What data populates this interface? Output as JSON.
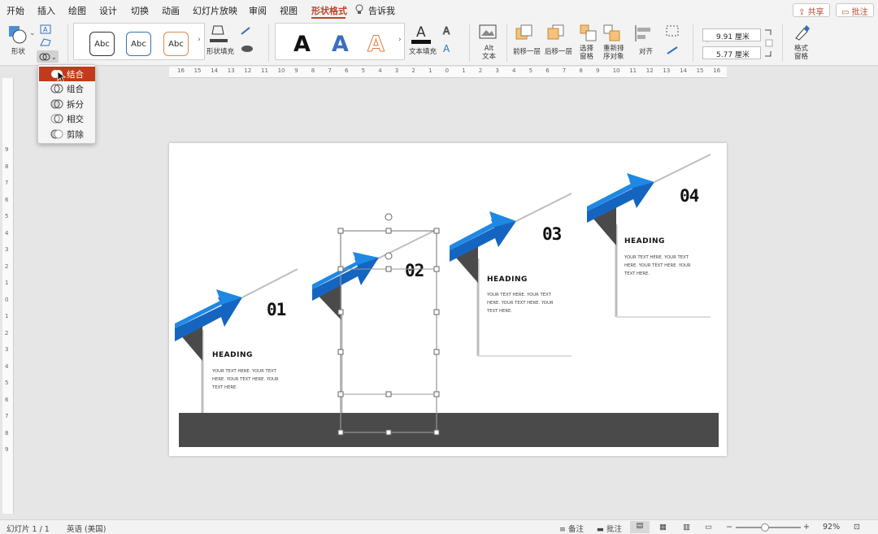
{
  "tabs": [
    {
      "label": "开始"
    },
    {
      "label": "插入"
    },
    {
      "label": "绘图"
    },
    {
      "label": "设计"
    },
    {
      "label": "切换"
    },
    {
      "label": "动画"
    },
    {
      "label": "幻灯片放映"
    },
    {
      "label": "审阅"
    },
    {
      "label": "视图"
    },
    {
      "label": "形状格式"
    },
    {
      "label": "告诉我"
    }
  ],
  "share_label": "共享",
  "comments_label": "批注",
  "ribbon": {
    "shapes": "形状",
    "style_sample": "Abc",
    "fill": "形状填充",
    "wordart_letter": "A",
    "text_fill": "文本填充",
    "alt_text": "Alt\n文本",
    "bring_forward": "前移一层",
    "send_backward": "后移一层",
    "selection_pane": "选择\n窗格",
    "reorder": "重新排\n序对象",
    "align": "对齐",
    "width": "9.91 厘米",
    "height": "5.77 厘米",
    "format_pane": "格式\n窗格"
  },
  "merge_menu": {
    "items": [
      {
        "label": "结合"
      },
      {
        "label": "组合"
      },
      {
        "label": "拆分"
      },
      {
        "label": "相交"
      },
      {
        "label": "剪除"
      }
    ]
  },
  "ruler": {
    "h": [
      "16",
      "15",
      "14",
      "13",
      "12",
      "11",
      "10",
      "9",
      "8",
      "7",
      "6",
      "5",
      "4",
      "3",
      "2",
      "1",
      "0",
      "1",
      "2",
      "3",
      "4",
      "5",
      "6",
      "7",
      "8",
      "9",
      "10",
      "11",
      "12",
      "13",
      "14",
      "15",
      "16"
    ],
    "v": [
      "9",
      "8",
      "7",
      "6",
      "5",
      "4",
      "3",
      "2",
      "1",
      "0",
      "1",
      "2",
      "3",
      "4",
      "5",
      "6",
      "7",
      "8",
      "9"
    ]
  },
  "slide": {
    "steps": [
      {
        "number": "01",
        "heading": "HEADING",
        "body": "YOUR TEXT HERE. YOUR TEXT HERE. YOUR TEXT HERE. YOUR TEXT HERE."
      },
      {
        "number": "02"
      },
      {
        "number": "03",
        "heading": "HEADING",
        "body": "YOUR TEXT HERE. YOUR TEXT HERE. YOUR TEXT HERE. YOUR TEXT HERE."
      },
      {
        "number": "04",
        "heading": "HEADING",
        "body": "YOUR TEXT HERE. YOUR TEXT HERE. YOUR TEXT HERE. YOUR TEXT HERE."
      }
    ]
  },
  "status": {
    "slide": "幻灯片 1 / 1",
    "lang": "英语 (美国)",
    "notes": "备注",
    "comments": "批注",
    "zoom": "92%"
  },
  "colors": {
    "accent": "#b7472a",
    "arrow_dark": "#1565c0",
    "arrow_light": "#1e88e5"
  }
}
